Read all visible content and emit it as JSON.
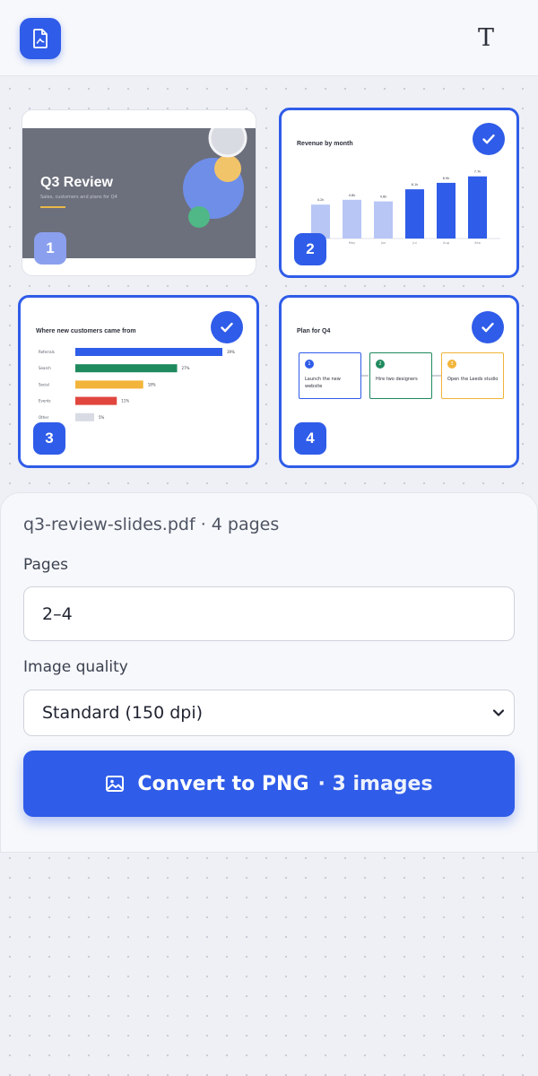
{
  "header": {
    "logo_icon": "pdf-file-icon",
    "text_tool_glyph": "T"
  },
  "slides": [
    {
      "page": "1",
      "selected": false,
      "title": "Q3 Review",
      "subtitle": "Sales, customers and plans for Q4"
    },
    {
      "page": "2",
      "selected": true,
      "title": "Revenue by month",
      "chart_data": {
        "type": "bar",
        "title": "Revenue by month",
        "categories": [
          "",
          "May",
          "Jun",
          "Jul",
          "Aug",
          "Sep"
        ],
        "value_labels": [
          "4.2k",
          "4.8k",
          "4.6k",
          "6.1k",
          "6.9k",
          "7.7k"
        ],
        "values": [
          4.2,
          4.8,
          4.6,
          6.1,
          6.9,
          7.7
        ],
        "highlight_from_index": 3,
        "colors": {
          "light": "#b8c6f5",
          "dark": "#2f5ce8"
        }
      }
    },
    {
      "page": "3",
      "selected": true,
      "title": "Where new customers came from",
      "chart_data": {
        "type": "bar",
        "orientation": "horizontal",
        "title": "Where new customers came from",
        "categories": [
          "Referrals",
          "Search",
          "Social",
          "Events",
          "Other"
        ],
        "value_labels": [
          "39%",
          "27%",
          "18%",
          "11%",
          "5%"
        ],
        "values": [
          39,
          27,
          18,
          11,
          5
        ],
        "colors": [
          "#2f5ce8",
          "#1f8a5e",
          "#f2b43a",
          "#e0463d",
          "#d8dbe3"
        ]
      }
    },
    {
      "page": "4",
      "selected": true,
      "title": "Plan for Q4",
      "steps": [
        {
          "n": "1",
          "label": "Launch the new website",
          "color": "#2f5ce8"
        },
        {
          "n": "2",
          "label": "Hire two designers",
          "color": "#1f8a5e"
        },
        {
          "n": "3",
          "label": "Open the Leeds studio",
          "color": "#f2b43a"
        }
      ]
    }
  ],
  "sheet": {
    "file_info": "q3-review-slides.pdf · 4 pages",
    "pages_label": "Pages",
    "pages_value": "2–4",
    "quality_label": "Image quality",
    "quality_value": "Standard (150 dpi)",
    "convert_label": "Convert to PNG",
    "convert_count": "· 3 images",
    "convert_icon": "image-icon"
  },
  "colors": {
    "accent": "#2f5ce8",
    "background": "#eef0f5"
  }
}
